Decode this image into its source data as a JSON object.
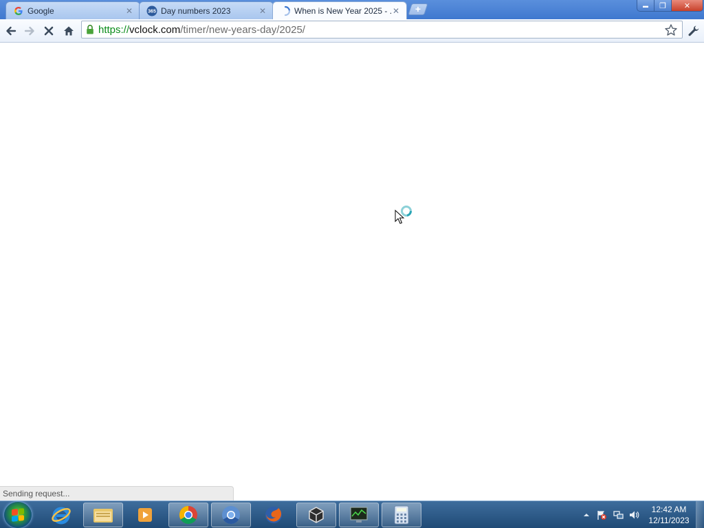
{
  "browser": {
    "tabs": [
      {
        "title": "Google",
        "favicon": "google-favicon",
        "active": false
      },
      {
        "title": "Day numbers 2023",
        "favicon": "365-favicon",
        "favicon_text": "365",
        "active": false
      },
      {
        "title": "When is New Year 2025 - ...",
        "favicon": "loading-spinner",
        "active": true
      }
    ],
    "new_tab_label": "+",
    "window_controls": {
      "minimize": "▬",
      "maximize": "❐",
      "close": "✕"
    },
    "url": {
      "scheme": "https://",
      "host": "vclock.com",
      "path": "/timer/new-years-day/2025/"
    },
    "status_text": "Sending request..."
  },
  "taskbar": {
    "apps": [
      {
        "name": "internet-explorer"
      },
      {
        "name": "windows-explorer"
      },
      {
        "name": "media-player"
      },
      {
        "name": "google-chrome",
        "open": true
      },
      {
        "name": "chromium",
        "open": true
      },
      {
        "name": "firefox"
      },
      {
        "name": "unity",
        "open": true
      },
      {
        "name": "task-manager"
      },
      {
        "name": "calculator"
      }
    ],
    "clock": {
      "time": "12:42 AM",
      "date": "12/11/2023"
    }
  },
  "colors": {
    "accent": "#3f78cf",
    "secure_scheme": "#0a8c1a",
    "taskbar": "#1f4a76"
  }
}
